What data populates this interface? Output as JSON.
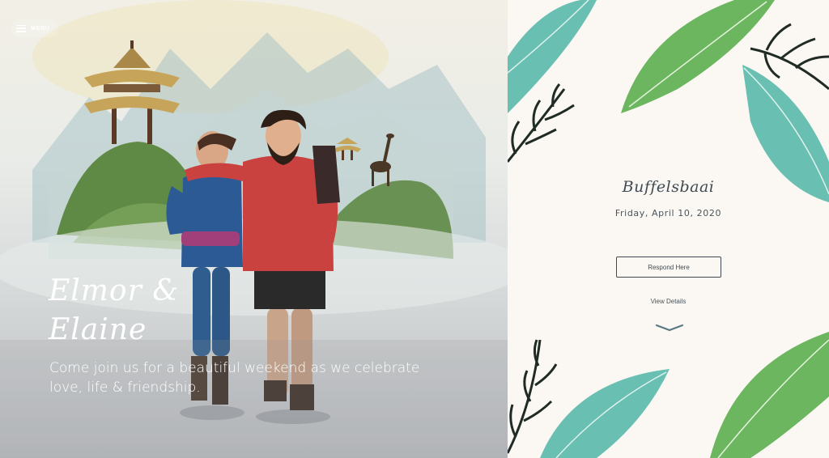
{
  "menu": {
    "label": "MENU",
    "icon": "hamburger-menu-icon"
  },
  "hero": {
    "title_line1": "Elmor &",
    "title_line2": "Elaine",
    "subtitle": "Come join us for a beautiful weekend as we celebrate love, life & friendship."
  },
  "event": {
    "venue": "Buffelsbaai",
    "date": "Friday, April 10, 2020",
    "respond_label": "Respond Here",
    "details_label": "View Details",
    "scroll_icon": "chevron-down-icon"
  },
  "colors": {
    "text_dark": "#3f4a52",
    "leaf_green": "#5cae4f",
    "leaf_teal": "#4fb5a6",
    "background": "#fbf8f3"
  }
}
